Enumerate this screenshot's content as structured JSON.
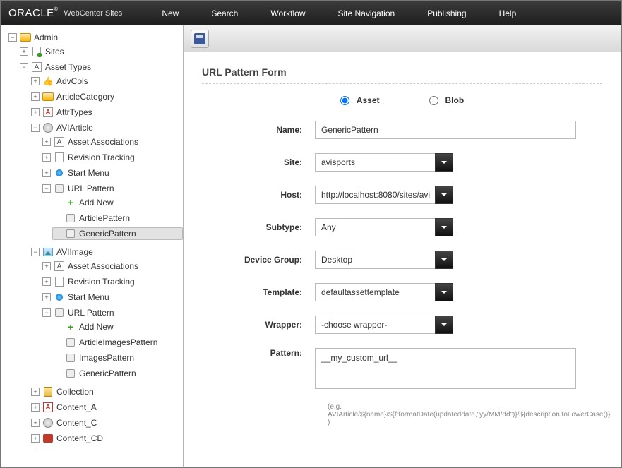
{
  "brand": {
    "logo": "ORACLE",
    "suite": "WebCenter Sites"
  },
  "menu": [
    "New",
    "Search",
    "Workflow",
    "Site Navigation",
    "Publishing",
    "Help"
  ],
  "tree": {
    "root": "Admin",
    "sites": "Sites",
    "assetTypes": "Asset Types",
    "advcols": "AdvCols",
    "articlecat": "ArticleCategory",
    "attrtypes": "AttrTypes",
    "aviarticle": "AVIArticle",
    "assetAssoc": "Asset Associations",
    "revTrack": "Revision Tracking",
    "startMenu": "Start Menu",
    "urlPattern": "URL Pattern",
    "addNew": "Add New",
    "articlePattern": "ArticlePattern",
    "genericPattern": "GenericPattern",
    "aviimage": "AVIImage",
    "articleImagesPattern": "ArticleImagesPattern",
    "imagesPattern": "ImagesPattern",
    "collection": "Collection",
    "contentA": "Content_A",
    "contentC": "Content_C",
    "contentCD": "Content_CD"
  },
  "form": {
    "title": "URL Pattern Form",
    "radioAsset": "Asset",
    "radioBlob": "Blob",
    "labels": {
      "name": "Name:",
      "site": "Site:",
      "host": "Host:",
      "subtype": "Subtype:",
      "deviceGroup": "Device Group:",
      "template": "Template:",
      "wrapper": "Wrapper:",
      "pattern": "Pattern:"
    },
    "values": {
      "name": "GenericPattern",
      "site": "avisports",
      "host": "http://localhost:8080/sites/avi",
      "subtype": "Any",
      "deviceGroup": "Desktop",
      "template": "defaultassettemplate",
      "wrapper": "-choose wrapper-",
      "pattern": "__my_custom_url__"
    },
    "hint": "(e.g. AVIArticle/${name}/${f:formatDate(updateddate,\"yy/MM/dd\")}/${description.toLowerCase()} )"
  }
}
